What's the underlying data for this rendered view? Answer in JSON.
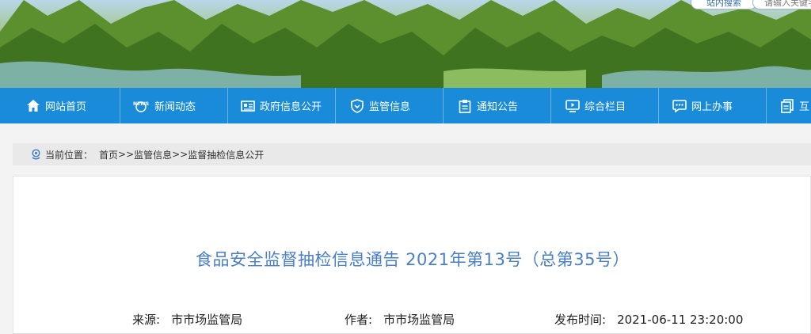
{
  "header": {
    "search_tab": "站内搜索",
    "search_placeholder": "请输入关键字"
  },
  "nav": {
    "items": [
      {
        "label": "网站首页",
        "icon": "home-icon"
      },
      {
        "label": "新闻动态",
        "icon": "news-icon"
      },
      {
        "label": "政府信息公开",
        "icon": "document-icon"
      },
      {
        "label": "监管信息",
        "icon": "shield-icon"
      },
      {
        "label": "通知公告",
        "icon": "clipboard-icon"
      },
      {
        "label": "综合栏目",
        "icon": "screen-icon"
      },
      {
        "label": "网上办事",
        "icon": "chat-icon"
      },
      {
        "label": "互",
        "icon": "copy-icon"
      }
    ]
  },
  "breadcrumb": {
    "prefix": "当前位置：",
    "home": "首页",
    "sep1": ">>",
    "level1": "监管信息",
    "sep2": ">>",
    "level2": "监督抽检信息公开"
  },
  "article": {
    "title": "食品安全监督抽检信息通告 2021年第13号（总第35号）",
    "source_label": "来源:",
    "source_value": "市市场监管局",
    "author_label": "作者:",
    "author_value": "市市场监管局",
    "date_label": "发布时间:",
    "date_value": "2021-06-11 23:20:00"
  },
  "colors": {
    "nav_bg": "#1a8bd8",
    "title": "#4a7fc4"
  }
}
